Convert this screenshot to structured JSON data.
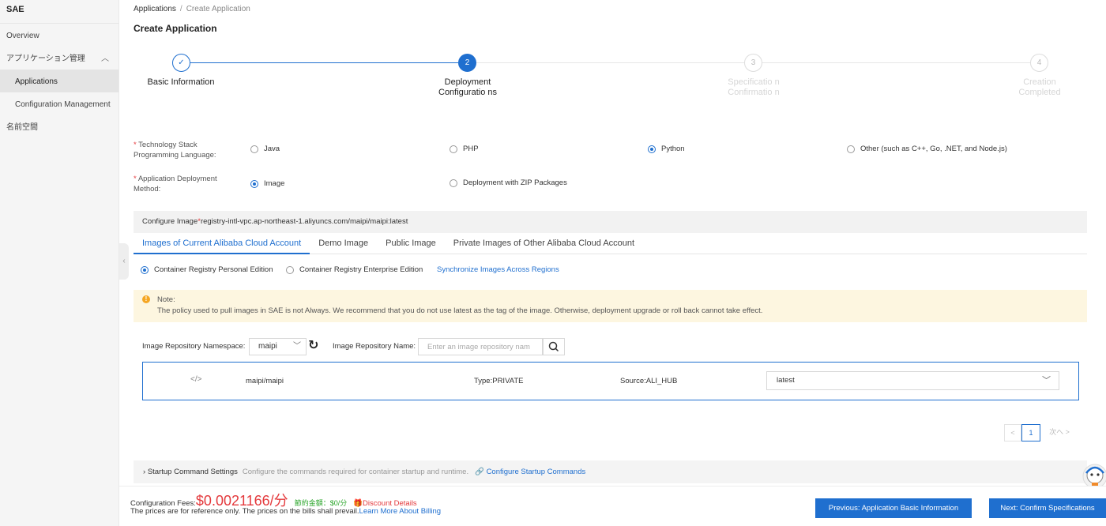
{
  "sidebar": {
    "title": "SAE",
    "items": [
      {
        "label": "Overview"
      },
      {
        "label": "アプリケーション管理"
      },
      {
        "label": "Applications"
      },
      {
        "label": "Configuration Management"
      },
      {
        "label": "名前空間"
      }
    ]
  },
  "breadcrumb": {
    "root": "Applications",
    "sep": "/",
    "current": "Create Application"
  },
  "page_title": "Create Application",
  "steps": [
    {
      "number": "✓",
      "label": "Basic Information",
      "state": "done"
    },
    {
      "number": "2",
      "label": "Deployment Configuratio ns",
      "state": "active"
    },
    {
      "number": "3",
      "label": "Specificatio n Confirmatio n",
      "state": "todo"
    },
    {
      "number": "4",
      "label": "Creation Completed",
      "state": "todo"
    }
  ],
  "form": {
    "tech_stack": {
      "required_mark": "*",
      "label": "Technology Stack Programming Language:",
      "options": [
        "Java",
        "PHP",
        "Python",
        "Other (such as C++, Go, .NET, and Node.js)"
      ],
      "selected": "Python"
    },
    "deploy_method": {
      "required_mark": "*",
      "label": "Application Deployment Method:",
      "options": [
        "Image",
        "Deployment with ZIP Packages"
      ],
      "selected": "Image"
    }
  },
  "image_config": {
    "label": "Configure Image",
    "required_mark": "*",
    "value": "registry-intl-vpc.ap-northeast-1.aliyuncs.com/maipi/maipi:latest",
    "tabs": [
      "Images of Current Alibaba Cloud Account",
      "Demo Image",
      "Public Image",
      "Private Images of Other Alibaba Cloud Account"
    ],
    "active_tab": "Images of Current Alibaba Cloud Account",
    "editions": [
      "Container Registry Personal Edition",
      "Container Registry Enterprise Edition"
    ],
    "selected_edition": "Container Registry Personal Edition",
    "sync_link": "Synchronize Images Across Regions",
    "note_title": "Note:",
    "note_text": "The policy used to pull images in SAE is not Always. We recommend that you do not use latest as the tag of the image. Otherwise, deployment upgrade or roll back cannot take effect.",
    "namespace_label": "Image Repository Namespace:",
    "namespace_value": "maipi",
    "repo_name_label": "Image Repository Name:",
    "repo_name_placeholder": "Enter an image repository nam",
    "repo": {
      "icon": "</>",
      "name": "maipi/maipi",
      "type": "Type:PRIVATE",
      "source": "Source:ALI_HUB",
      "tag": "latest"
    },
    "pager": {
      "prev": "<",
      "current": "1",
      "next": "次へ >"
    }
  },
  "startup": {
    "title": "Startup Command Settings",
    "desc": "Configure the commands required for container startup and runtime.",
    "link": "Configure Startup Commands"
  },
  "footer": {
    "fee_label": "Configuration Fees:",
    "fee_amount": "$0.0021166/分",
    "discount_amount": "節約金額：$0/分",
    "discount_details": "Discount Details",
    "note": "The prices are for reference only. The prices on the bills shall prevail.",
    "billing_link": "Learn More About Billing",
    "prev_button": "Previous: Application Basic Information",
    "next_button": "Next: Confirm Specifications"
  },
  "colors": {
    "accent": "#1f6fcf",
    "price": "#e4393c",
    "discount": "#2aa52a",
    "note_bg": "#fdf6e0"
  }
}
